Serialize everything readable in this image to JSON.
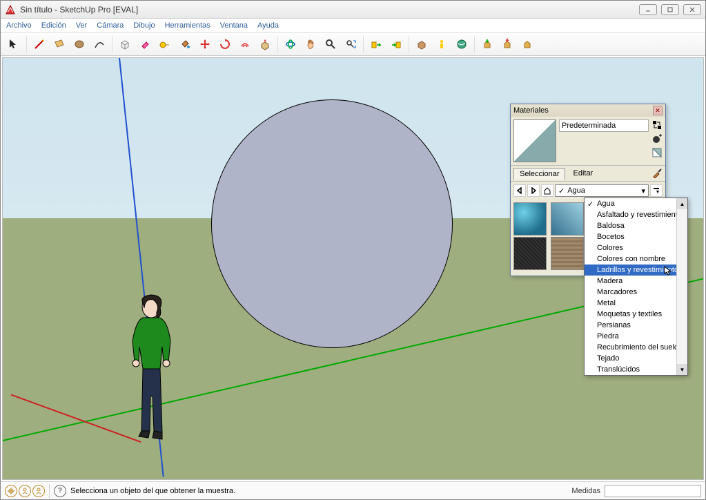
{
  "window": {
    "title": "Sin título - SketchUp Pro [EVAL]"
  },
  "menu": [
    "Archivo",
    "Edición",
    "Ver",
    "Cámara",
    "Dibujo",
    "Herramientas",
    "Ventana",
    "Ayuda"
  ],
  "toolbar_icons": [
    "select",
    "sep",
    "pencil",
    "rectangle",
    "circle",
    "arc",
    "sep",
    "push-pull",
    "eraser",
    "tape-measure",
    "paint-bucket",
    "move",
    "rotate",
    "scale",
    "offset",
    "sep",
    "orbit",
    "pan",
    "zoom",
    "zoom-extents",
    "sep",
    "undo",
    "redo",
    "sep",
    "layers",
    "person",
    "google-earth",
    "sep",
    "component-download",
    "component-upload",
    "share"
  ],
  "materials": {
    "panel_title": "Materiales",
    "material_name": "Predeterminada",
    "tabs": {
      "select": "Seleccionar",
      "edit": "Editar"
    },
    "active_tab": "select",
    "combo_value": "Agua",
    "dropdown": {
      "items": [
        "Agua",
        "Asfaltado y revestimientos",
        "Baldosa",
        "Bocetos",
        "Colores",
        "Colores con nombre",
        "Ladrillos y revestimientos",
        "Madera",
        "Marcadores",
        "Metal",
        "Moquetas y textiles",
        "Persianas",
        "Piedra",
        "Recubrimiento del suelo",
        "Tejado",
        "Translúcidos"
      ],
      "checked_index": 0,
      "highlighted_index": 6
    }
  },
  "statusbar": {
    "hint": "Selecciona un objeto del que obtener la muestra.",
    "medidas_label": "Medidas",
    "medidas_value": ""
  }
}
